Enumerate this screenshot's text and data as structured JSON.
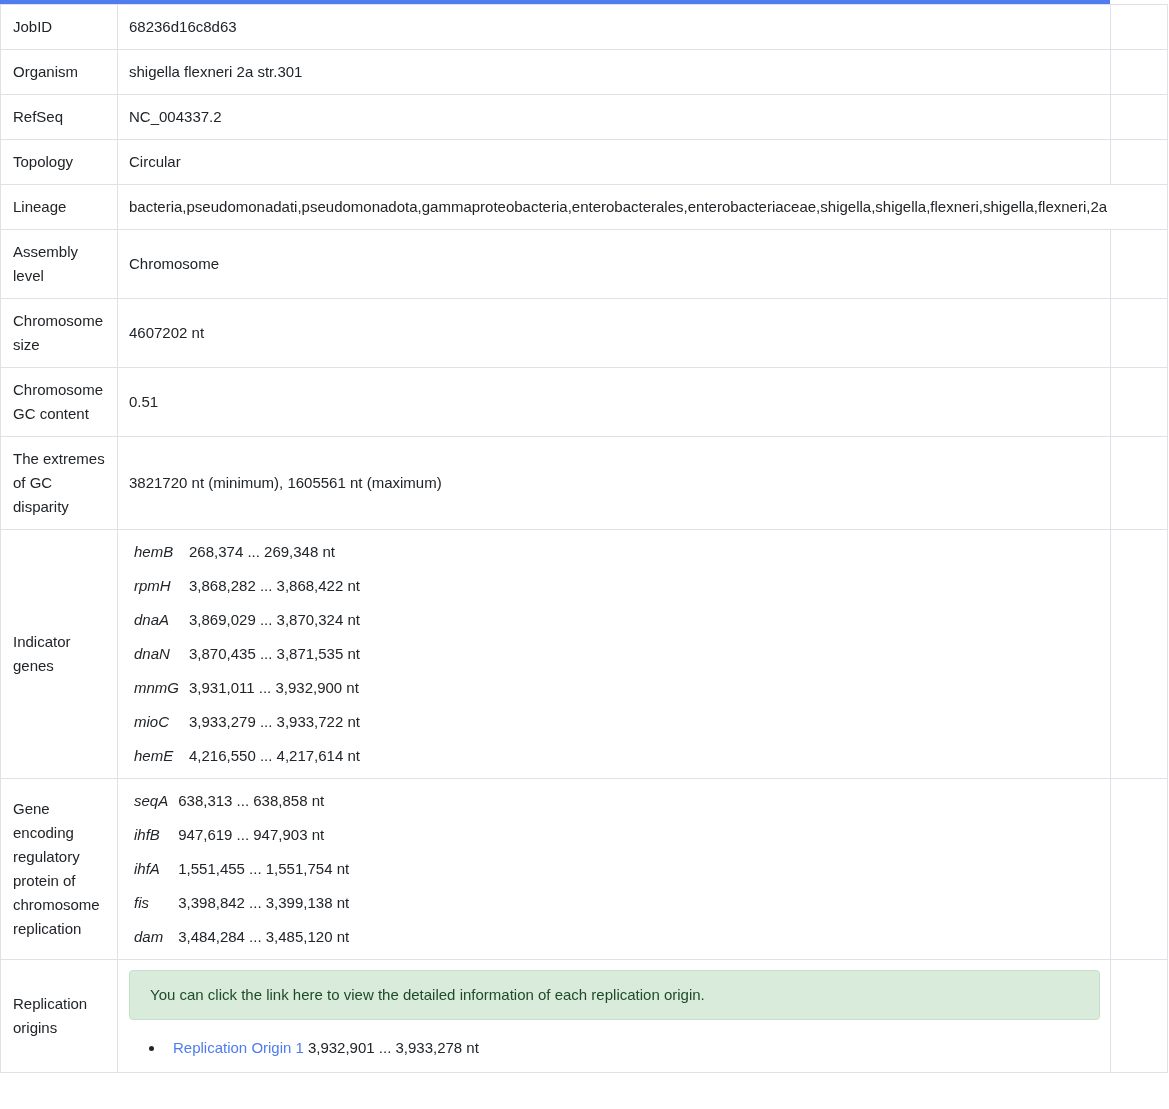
{
  "progress": {
    "level": 0.951
  },
  "rows": [
    {
      "label": "JobID",
      "kind": "text",
      "value": "68236d16c8d63"
    },
    {
      "label": "Organism",
      "kind": "text",
      "value": "shigella flexneri 2a str.301"
    },
    {
      "label": "RefSeq",
      "kind": "text",
      "value": "NC_004337.2"
    },
    {
      "label": "Topology",
      "kind": "text",
      "value": "Circular"
    },
    {
      "label": "Lineage",
      "kind": "text",
      "value": "bacteria,pseudomonadati,pseudomonadota,gammaproteobacteria,enterobacterales,enterobacteriaceae,shigella,shigella,flexneri,shigella,flexneri,2a"
    },
    {
      "label": "Assembly level",
      "kind": "text",
      "value": "Chromosome"
    },
    {
      "label": "Chromosome size",
      "kind": "text",
      "value": "4607202 nt"
    },
    {
      "label": "Chromosome GC content",
      "kind": "text",
      "value": "0.51"
    },
    {
      "label": "The extremes of GC disparity",
      "kind": "text",
      "value": "3821720 nt (minimum), 1605561 nt (maximum)"
    },
    {
      "label": "Indicator genes",
      "kind": "genes",
      "genes": [
        {
          "name": "hemB",
          "range": "268,374 ... 269,348 nt"
        },
        {
          "name": "rpmH",
          "range": "3,868,282 ... 3,868,422 nt"
        },
        {
          "name": "dnaA",
          "range": "3,869,029 ... 3,870,324 nt"
        },
        {
          "name": "dnaN",
          "range": "3,870,435 ... 3,871,535 nt"
        },
        {
          "name": "mnmG",
          "range": "3,931,011 ... 3,932,900 nt"
        },
        {
          "name": "mioC",
          "range": "3,933,279 ... 3,933,722 nt"
        },
        {
          "name": "hemE",
          "range": "4,216,550 ... 4,217,614 nt"
        }
      ]
    },
    {
      "label": "Gene encoding regulatory protein of chromosome replication",
      "kind": "genes",
      "genes": [
        {
          "name": "seqA",
          "range": "638,313 ... 638,858 nt"
        },
        {
          "name": "ihfB",
          "range": "947,619 ... 947,903 nt"
        },
        {
          "name": "ihfA",
          "range": "1,551,455 ... 1,551,754 nt"
        },
        {
          "name": "fis",
          "range": "3,398,842 ... 3,399,138 nt"
        },
        {
          "name": "dam",
          "range": "3,484,284 ... 3,485,120 nt"
        }
      ]
    },
    {
      "label": "Replication origins",
      "kind": "origins",
      "notice": "You can click the link here to view the detailed information of each replication origin.",
      "origins": [
        {
          "link": "Replication Origin 1",
          "range": "3,932,901 ... 3,933,278 nt"
        }
      ]
    }
  ]
}
